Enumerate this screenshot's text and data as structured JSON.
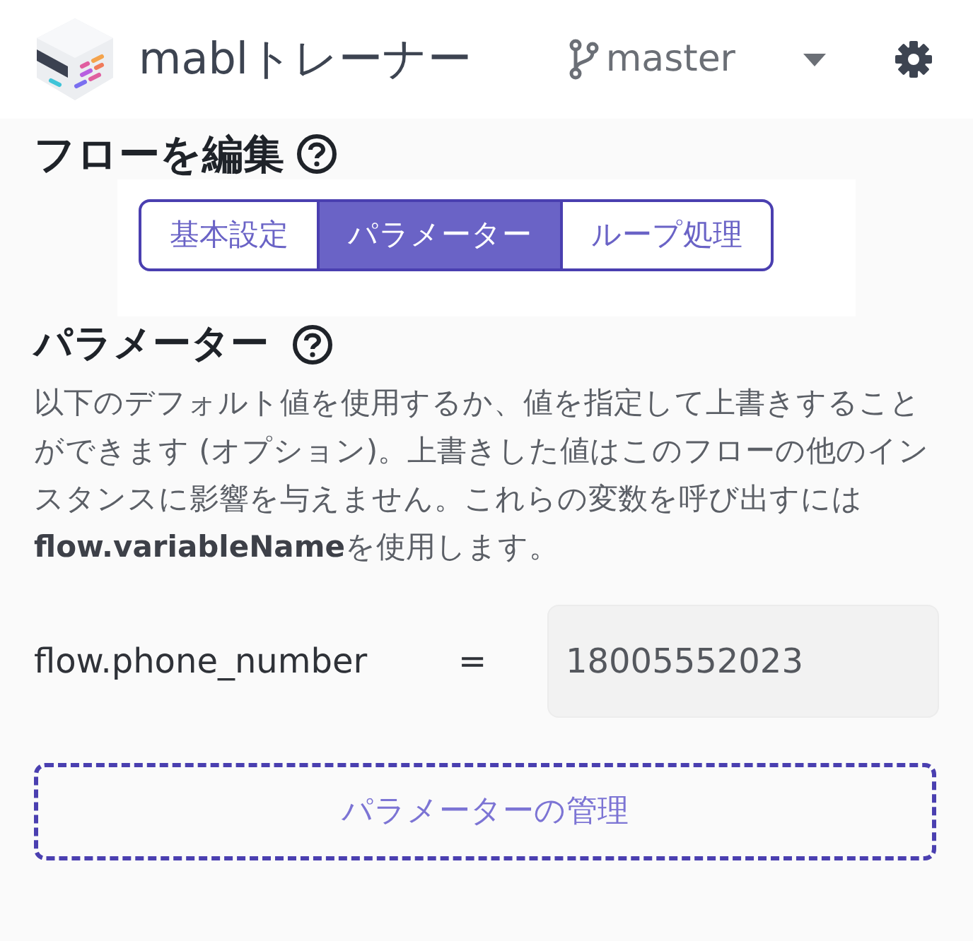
{
  "header": {
    "app_title": "mablトレーナー",
    "branch": "master"
  },
  "page_title": "フローを編集",
  "tabs": [
    {
      "label": "基本設定",
      "selected": false
    },
    {
      "label": "パラメーター",
      "selected": true
    },
    {
      "label": "ループ処理",
      "selected": false
    }
  ],
  "section": {
    "heading": "パラメーター",
    "description": "以下のデフォルト値を使用するか、値を指定して上書きすることができます (オプション)。上書きした値はこのフローの他のインスタンスに影響を与えません。これらの変数を呼び出すには**flow.variableName**を使用します。"
  },
  "parameters": [
    {
      "name": "flow.phone_number",
      "operator": "=",
      "value": "18005552023"
    }
  ],
  "manage_button": "パラメーターの管理"
}
